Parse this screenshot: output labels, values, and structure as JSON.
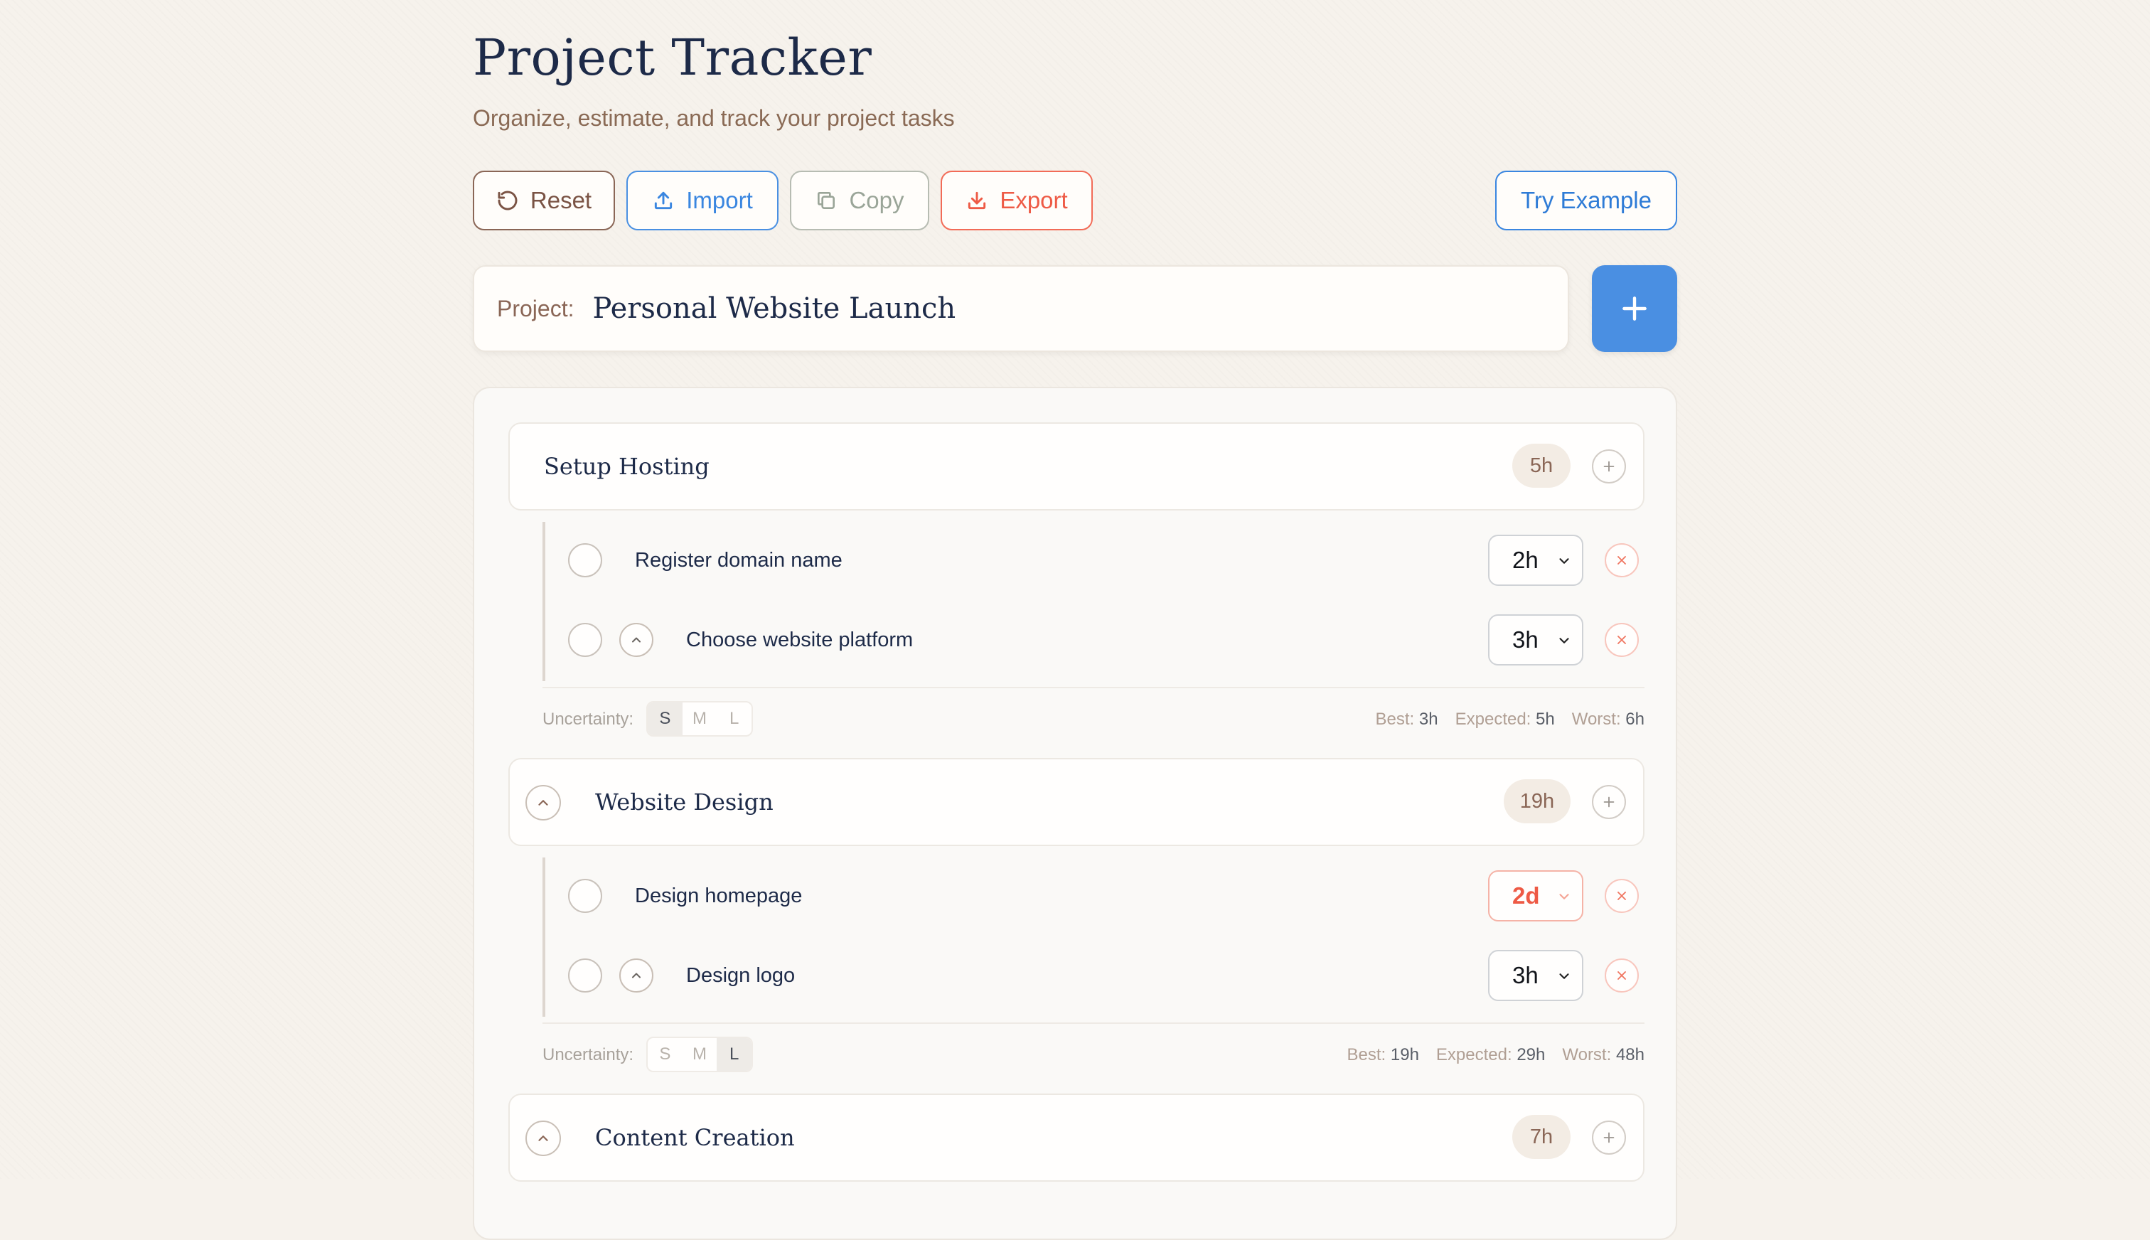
{
  "header": {
    "title": "Project Tracker",
    "subtitle": "Organize, estimate, and track your project tasks"
  },
  "toolbar": {
    "reset_label": "Reset",
    "import_label": "Import",
    "copy_label": "Copy",
    "export_label": "Export",
    "example_label": "Try Example"
  },
  "project": {
    "label": "Project:",
    "name": "Personal Website Launch"
  },
  "groups": [
    {
      "title": "Setup Hosting",
      "hours": "5h",
      "tasks": [
        {
          "name": "Register domain name",
          "estimate": "2h"
        },
        {
          "name": "Choose website platform",
          "estimate": "3h"
        }
      ],
      "uncertainty_label": "Uncertainty:",
      "uncertainty_options": [
        "S",
        "M",
        "L"
      ],
      "uncertainty_selected": "S",
      "best_label": "Best:",
      "best": "3h",
      "expected_label": "Expected:",
      "expected": "5h",
      "worst_label": "Worst:",
      "worst": "6h"
    },
    {
      "title": "Website Design",
      "hours": "19h",
      "tasks": [
        {
          "name": "Design homepage",
          "estimate": "2d"
        },
        {
          "name": "Design logo",
          "estimate": "3h"
        }
      ],
      "uncertainty_label": "Uncertainty:",
      "uncertainty_options": [
        "S",
        "M",
        "L"
      ],
      "uncertainty_selected": "L",
      "best_label": "Best:",
      "best": "19h",
      "expected_label": "Expected:",
      "expected": "29h",
      "worst_label": "Worst:",
      "worst": "48h"
    },
    {
      "title": "Content Creation",
      "hours": "7h"
    }
  ],
  "icons": {
    "reset": "rotate-ccw-icon",
    "import": "upload-icon",
    "copy": "copy-icon",
    "export": "download-icon",
    "add": "plus-icon",
    "remove": "x-icon",
    "collapse": "chevron-up-icon",
    "dropdown": "chevron-down-icon"
  },
  "colors": {
    "accent_blue": "#4a8fe2",
    "danger": "#ee5a45",
    "brown": "#8a6656",
    "navy": "#1d2a48"
  }
}
